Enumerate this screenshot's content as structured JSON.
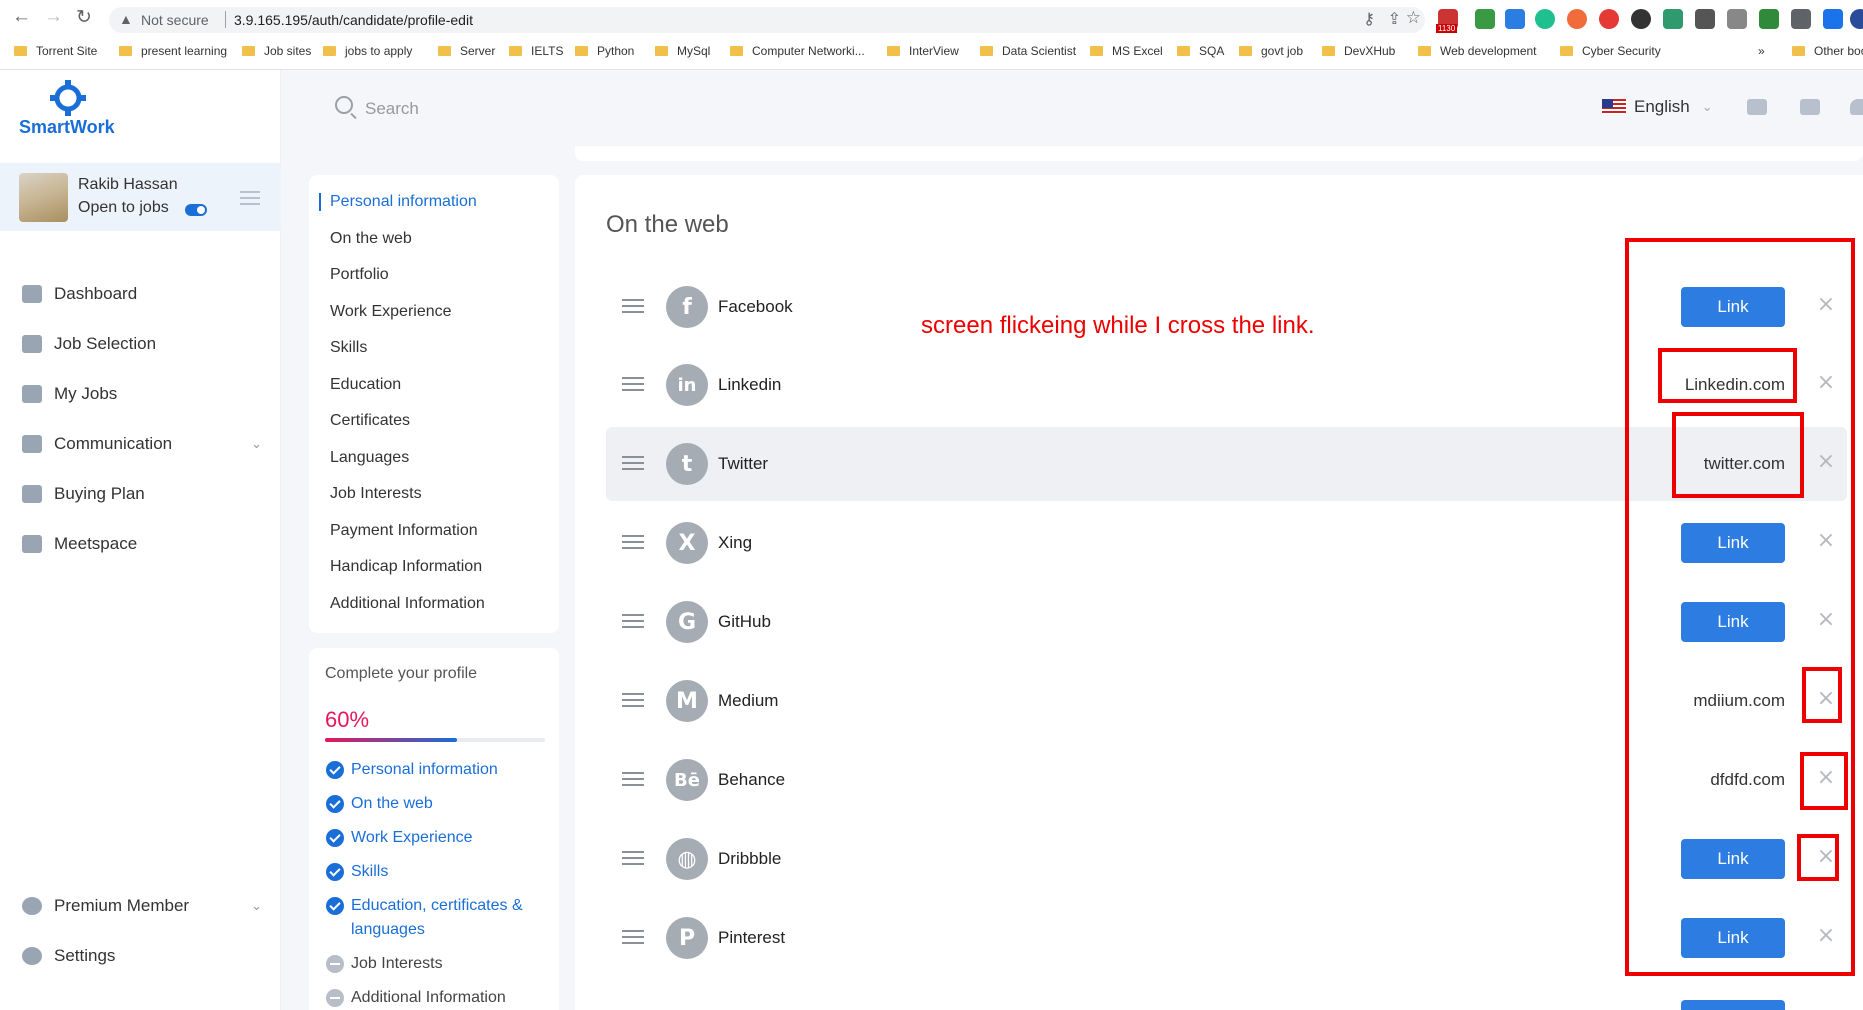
{
  "browser": {
    "address": {
      "security": "Not secure",
      "url": "3.9.165.195/auth/candidate/profile-edit"
    },
    "ext_badge": "1130",
    "bookmarks": [
      "Torrent Site",
      "present learning",
      "Job sites",
      "jobs to apply",
      "Server",
      "IELTS",
      "Python",
      "MySql",
      "Computer Networki...",
      "InterView",
      "Data Scientist",
      "MS Excel",
      "SQA",
      "govt job",
      "DevXHub",
      "Web development",
      "Cyber Security",
      "»",
      "Other boo"
    ]
  },
  "brand": {
    "name": "SmartWork",
    "color": "#1a6ed8"
  },
  "user": {
    "name": "Rakib Hassan",
    "status": "Open to jobs"
  },
  "sidebar": {
    "items": [
      {
        "label": "Dashboard",
        "icon": "dashboard-icon"
      },
      {
        "label": "Job Selection",
        "icon": "briefcase-icon"
      },
      {
        "label": "My Jobs",
        "icon": "jobs-icon"
      },
      {
        "label": "Communication",
        "icon": "chat-icon"
      },
      {
        "label": "Buying Plan",
        "icon": "plan-icon"
      },
      {
        "label": "Meetspace",
        "icon": "plus-icon"
      }
    ],
    "premium": "Premium Member",
    "settings": "Settings"
  },
  "header": {
    "search_placeholder": "Search",
    "language": "English"
  },
  "profile_menu": [
    "Personal information",
    "On the web",
    "Portfolio",
    "Work Experience",
    "Skills",
    "Education",
    "Certificates",
    "Languages",
    "Job Interests",
    "Payment Information",
    "Handicap Information",
    "Additional Information"
  ],
  "completion": {
    "title": "Complete your profile",
    "percent_label": "60%",
    "percent": 60,
    "items": [
      {
        "label": "Personal information",
        "done": true
      },
      {
        "label": "On the web",
        "done": true
      },
      {
        "label": "Work Experience",
        "done": true
      },
      {
        "label": "Skills",
        "done": true
      },
      {
        "label": "Education, certificates & languages",
        "done": true
      },
      {
        "label": "Job Interests",
        "done": false
      },
      {
        "label": "Additional Information",
        "done": false
      }
    ]
  },
  "main": {
    "title": "On the web",
    "link_label": "Link",
    "close_glyph": "×",
    "socials": [
      {
        "name": "Facebook",
        "icon": "facebook-icon",
        "glyph": "f",
        "value": ""
      },
      {
        "name": "Linkedin",
        "icon": "linkedin-icon",
        "glyph": "in",
        "value": "Linkedin.com"
      },
      {
        "name": "Twitter",
        "icon": "twitter-icon",
        "glyph": "t",
        "value": "twitter.com"
      },
      {
        "name": "Xing",
        "icon": "xing-icon",
        "glyph": "X",
        "value": ""
      },
      {
        "name": "GitHub",
        "icon": "github-icon",
        "glyph": "G",
        "value": ""
      },
      {
        "name": "Medium",
        "icon": "medium-icon",
        "glyph": "M",
        "value": "mdiium.com"
      },
      {
        "name": "Behance",
        "icon": "behance-icon",
        "glyph": "Bē",
        "value": "dfdfd.com"
      },
      {
        "name": "Dribbble",
        "icon": "dribbble-icon",
        "glyph": "◍",
        "value": ""
      },
      {
        "name": "Pinterest",
        "icon": "pinterest-icon",
        "glyph": "P",
        "value": ""
      }
    ]
  },
  "annotation": {
    "text": "screen flickeing while I cross the link.",
    "color": "#e00000"
  }
}
